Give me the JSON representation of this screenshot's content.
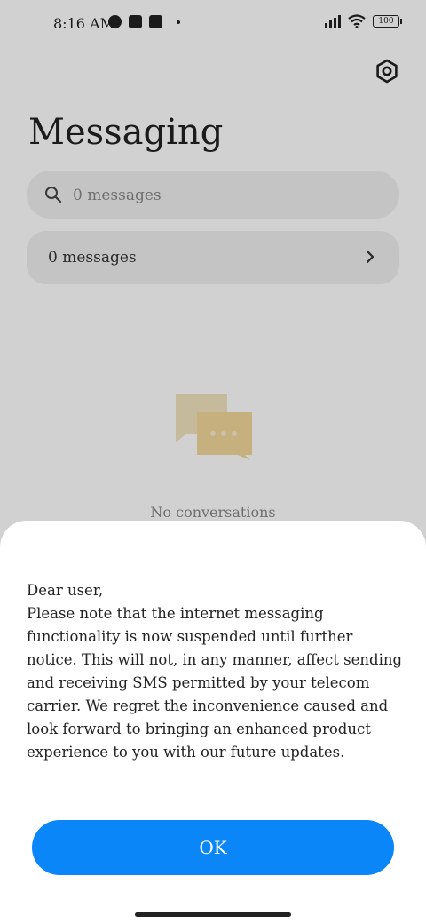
{
  "status_bar": {
    "time": "8:16 AM",
    "battery": "100",
    "icons": [
      "pinwheel-icon",
      "square-icon",
      "upload-icon",
      "dot-icon",
      "signal-icon",
      "wifi-icon",
      "battery-icon"
    ]
  },
  "header": {
    "title": "Messaging",
    "settings_icon": "gear-icon"
  },
  "search": {
    "placeholder": "0 messages"
  },
  "messages_row": {
    "label": "0 messages"
  },
  "empty_state": {
    "text": "No conversations"
  },
  "dialog": {
    "greeting": "Dear user,",
    "body": "Please note that the internet messaging functionality is now suspended until further notice. This will not, in any manner, affect sending and receiving SMS permitted by your telecom carrier. We regret the inconvenience caused and look forward to bringing an enhanced product experience to you with our future updates.",
    "ok_label": "OK"
  },
  "colors": {
    "accent": "#0a86f9",
    "illustration": "#f2d79a"
  }
}
